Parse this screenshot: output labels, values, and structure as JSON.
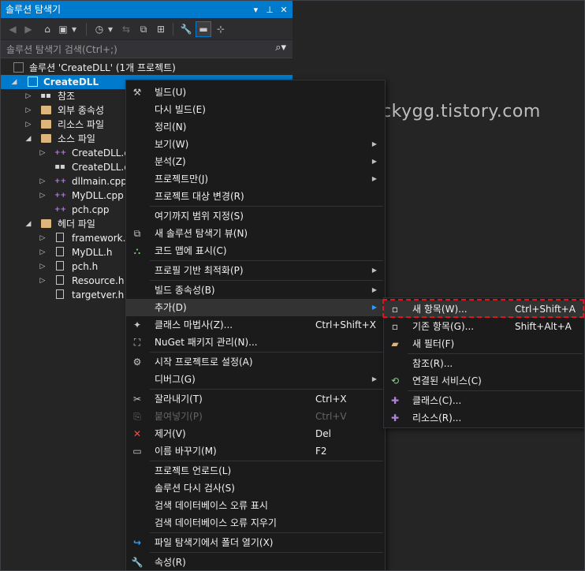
{
  "panel": {
    "title": "솔루션 탐색기",
    "search_placeholder": "솔루션 탐색기 검색(Ctrl+;)"
  },
  "tree": {
    "solution": "솔루션 'CreateDLL' (1개 프로젝트)",
    "project": "CreateDLL",
    "items": [
      {
        "label": "참조",
        "icon": "reference-icon"
      },
      {
        "label": "외부 종속성",
        "icon": "dependency-icon"
      },
      {
        "label": "리소스 파일",
        "icon": "folder-icon"
      },
      {
        "label": "소스 파일",
        "icon": "folder-icon"
      },
      {
        "label": "CreateDLL.cpp",
        "icon": "cpp-file-icon"
      },
      {
        "label": "CreateDLL.def",
        "icon": "def-file-icon"
      },
      {
        "label": "dllmain.cpp",
        "icon": "cpp-file-icon"
      },
      {
        "label": "MyDLL.cpp",
        "icon": "cpp-file-icon"
      },
      {
        "label": "pch.cpp",
        "icon": "cpp-file-icon"
      },
      {
        "label": "헤더 파일",
        "icon": "folder-icon"
      },
      {
        "label": "framework.h",
        "icon": "header-file-icon"
      },
      {
        "label": "MyDLL.h",
        "icon": "header-file-icon"
      },
      {
        "label": "pch.h",
        "icon": "header-file-icon"
      },
      {
        "label": "Resource.h",
        "icon": "header-file-icon"
      },
      {
        "label": "targetver.h",
        "icon": "header-file-icon"
      }
    ]
  },
  "menu": {
    "items": [
      {
        "label": "빌드(U)"
      },
      {
        "label": "다시 빌드(E)"
      },
      {
        "label": "정리(N)"
      },
      {
        "label": "보기(W)"
      },
      {
        "label": "분석(Z)"
      },
      {
        "label": "프로젝트만(J)"
      },
      {
        "label": "프로젝트 대상 변경(R)"
      },
      {
        "label": "여기까지 범위 지정(S)"
      },
      {
        "label": "새 솔루션 탐색기 뷰(N)"
      },
      {
        "label": "코드 맵에 표시(C)"
      },
      {
        "label": "프로필 기반 최적화(P)"
      },
      {
        "label": "빌드 종속성(B)"
      },
      {
        "label": "추가(D)"
      },
      {
        "label": "클래스 마법사(Z)...",
        "shortcut": "Ctrl+Shift+X"
      },
      {
        "label": "NuGet 패키지 관리(N)..."
      },
      {
        "label": "시작 프로젝트로 설정(A)"
      },
      {
        "label": "디버그(G)"
      },
      {
        "label": "잘라내기(T)",
        "shortcut": "Ctrl+X"
      },
      {
        "label": "붙여넣기(P)",
        "shortcut": "Ctrl+V"
      },
      {
        "label": "제거(V)",
        "shortcut": "Del"
      },
      {
        "label": "이름 바꾸기(M)",
        "shortcut": "F2"
      },
      {
        "label": "프로젝트 언로드(L)"
      },
      {
        "label": "솔루션 다시 검사(S)"
      },
      {
        "label": "검색 데이터베이스 오류 표시"
      },
      {
        "label": "검색 데이터베이스 오류 지우기"
      },
      {
        "label": "파일 탐색기에서 폴더 열기(X)"
      },
      {
        "label": "속성(R)"
      }
    ]
  },
  "submenu": {
    "items": [
      {
        "label": "새 항목(W)...",
        "shortcut": "Ctrl+Shift+A"
      },
      {
        "label": "기존 항목(G)...",
        "shortcut": "Shift+Alt+A"
      },
      {
        "label": "새 필터(F)"
      },
      {
        "label": "참조(R)..."
      },
      {
        "label": "연결된 서비스(C)"
      },
      {
        "label": "클래스(C)..."
      },
      {
        "label": "리소스(R)..."
      }
    ]
  },
  "watermark": "luckygg.tistory.com",
  "colors": {
    "accent": "#007acc",
    "highlight_border": "#e0141e",
    "menu_bg": "#1b1b1c",
    "panel_bg": "#252526"
  }
}
